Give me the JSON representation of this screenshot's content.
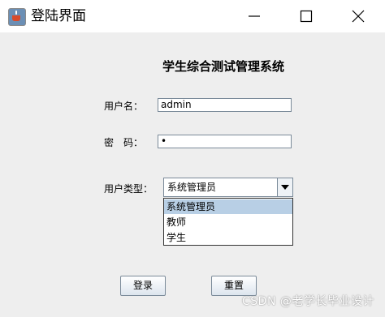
{
  "window": {
    "title": "登陆界面",
    "controls": {
      "minimize": "minimize",
      "maximize": "maximize",
      "close": "close"
    }
  },
  "main": {
    "system_title": "学生综合测试管理系统",
    "username_label": "用户名：",
    "username_value": "admin",
    "password_label": "密　码：",
    "password_value": "•",
    "usertype_label": "用户类型：",
    "usertype_selected": "系统管理员",
    "usertype_options": [
      "系统管理员",
      "教师",
      "学生"
    ]
  },
  "buttons": {
    "login": "登录",
    "reset": "重置"
  },
  "watermark": "CSDN @老学长毕业设计",
  "colors": {
    "titlebar": "#ffffff",
    "window_bg": "#eeeeee",
    "selected_option": "#b8cfe5"
  },
  "icons": [
    "java-app-icon",
    "minimize-icon",
    "maximize-icon",
    "close-icon",
    "chevron-down-icon"
  ]
}
